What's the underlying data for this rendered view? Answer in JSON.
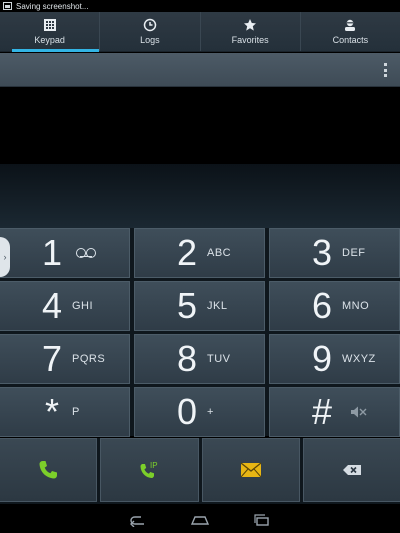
{
  "status_bar": {
    "notification_text": "Saving screenshot..."
  },
  "tabs": [
    {
      "label": "Keypad",
      "icon": "dialpad-icon",
      "active": true
    },
    {
      "label": "Logs",
      "icon": "clock-icon",
      "active": false
    },
    {
      "label": "Favorites",
      "icon": "star-icon",
      "active": false
    },
    {
      "label": "Contacts",
      "icon": "contact-person-icon",
      "active": false
    }
  ],
  "display": {
    "dialed_number": ""
  },
  "keys": [
    {
      "digit": "1",
      "sub": "",
      "icon": "voicemail-icon"
    },
    {
      "digit": "2",
      "sub": "ABC"
    },
    {
      "digit": "3",
      "sub": "DEF"
    },
    {
      "digit": "4",
      "sub": "GHI"
    },
    {
      "digit": "5",
      "sub": "JKL"
    },
    {
      "digit": "6",
      "sub": "MNO"
    },
    {
      "digit": "7",
      "sub": "PQRS"
    },
    {
      "digit": "8",
      "sub": "TUV"
    },
    {
      "digit": "9",
      "sub": "WXYZ"
    },
    {
      "digit": "*",
      "sub": "P"
    },
    {
      "digit": "0",
      "sub": "+"
    },
    {
      "digit": "#",
      "sub": "",
      "icon": "mute-speaker-icon"
    }
  ],
  "bottom_actions": {
    "call_icon": "phone-call-icon",
    "ip_call_label": "IP",
    "message_icon": "envelope-icon",
    "backspace_icon": "backspace-icon"
  },
  "colors": {
    "accent_blue": "#33b5e5",
    "call_green": "#7ccf2a",
    "message_yellow": "#e8b614"
  },
  "nav_bar": {
    "icons": [
      "back-icon",
      "home-icon",
      "recent-apps-icon"
    ]
  }
}
